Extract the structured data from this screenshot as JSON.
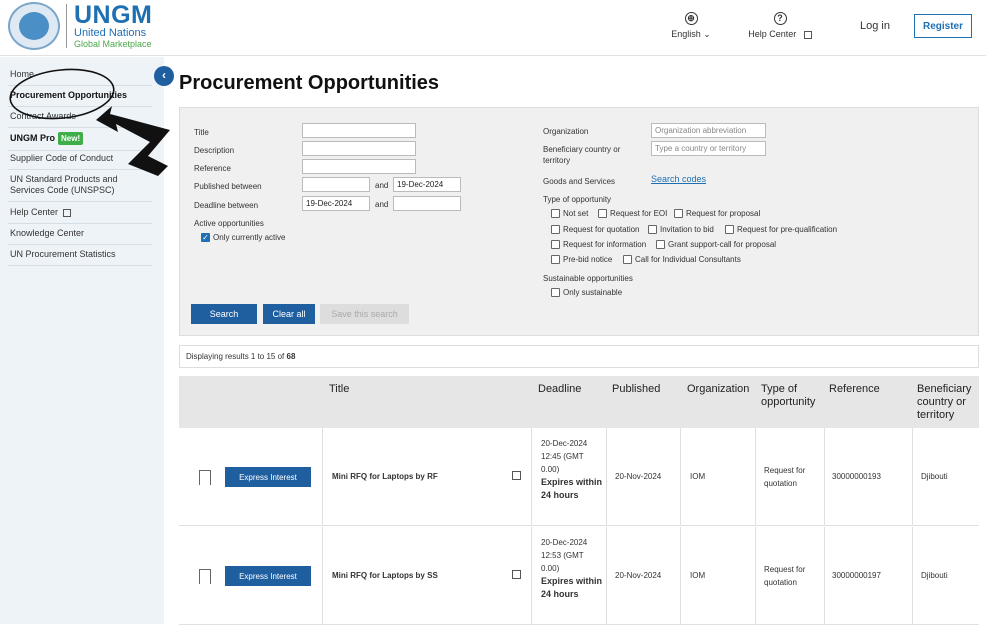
{
  "header": {
    "brand_main": "UNGM",
    "brand_sub1": "United Nations",
    "brand_sub2": "Global Marketplace",
    "language_label": "English",
    "help_label": "Help Center",
    "login_label": "Log in",
    "register_label": "Register"
  },
  "sidebar": {
    "items": [
      {
        "label": "Home"
      },
      {
        "label": "Procurement Opportunities"
      },
      {
        "label": "Contract Awards"
      },
      {
        "label": "UNGM Pro",
        "badge": "New!"
      },
      {
        "label": "Supplier Code of Conduct"
      },
      {
        "label": "UN Standard Products and Services Code (UNSPSC)"
      },
      {
        "label": "Help Center"
      },
      {
        "label": "Knowledge Center"
      },
      {
        "label": "UN Procurement Statistics"
      }
    ]
  },
  "page_title": "Procurement Opportunities",
  "filters": {
    "title_label": "Title",
    "description_label": "Description",
    "reference_label": "Reference",
    "published_label": "Published between",
    "deadline_label": "Deadline between",
    "and_label": "and",
    "published_to": "19-Dec-2024",
    "deadline_from": "19-Dec-2024",
    "active_label": "Active opportunities",
    "only_active_label": "Only currently active",
    "organization_label": "Organization",
    "organization_placeholder": "Organization abbreviation",
    "beneficiary_label": "Beneficiary country or territory",
    "beneficiary_placeholder": "Type a country or territory",
    "goods_label": "Goods and Services",
    "search_codes_label": "Search codes",
    "type_label": "Type of opportunity",
    "types": [
      "Not set",
      "Request for EOI",
      "Request for proposal",
      "Request for quotation",
      "Invitation to bid",
      "Request for pre-qualification",
      "Request for information",
      "Grant support-call for proposal",
      "Pre-bid notice",
      "Call for Individual Consultants"
    ],
    "sustainable_label": "Sustainable opportunities",
    "only_sustainable_label": "Only sustainable",
    "search_button": "Search",
    "clear_button": "Clear all",
    "save_button": "Save this search"
  },
  "results": {
    "prefix": "Displaying results 1 to 15 of ",
    "total": "68"
  },
  "table": {
    "columns": [
      "Title",
      "Deadline",
      "Published",
      "Organization",
      "Type of opportunity",
      "Reference",
      "Beneficiary country or territory"
    ],
    "express_label": "Express Interest",
    "rows": [
      {
        "title": "Mini RFQ for Laptops by RF",
        "deadline": "20-Dec-2024 12:45 (GMT 0.00)",
        "expires": "Expires within 24 hours",
        "published": "20-Nov-2024",
        "organization": "IOM",
        "type": "Request for quotation",
        "reference": "30000000193",
        "beneficiary": "Djibouti"
      },
      {
        "title": "Mini RFQ for Laptops by SS",
        "deadline": "20-Dec-2024 12:53 (GMT 0.00)",
        "expires": "Expires within 24 hours",
        "published": "20-Nov-2024",
        "organization": "IOM",
        "type": "Request for quotation",
        "reference": "30000000197",
        "beneficiary": "Djibouti"
      }
    ]
  }
}
